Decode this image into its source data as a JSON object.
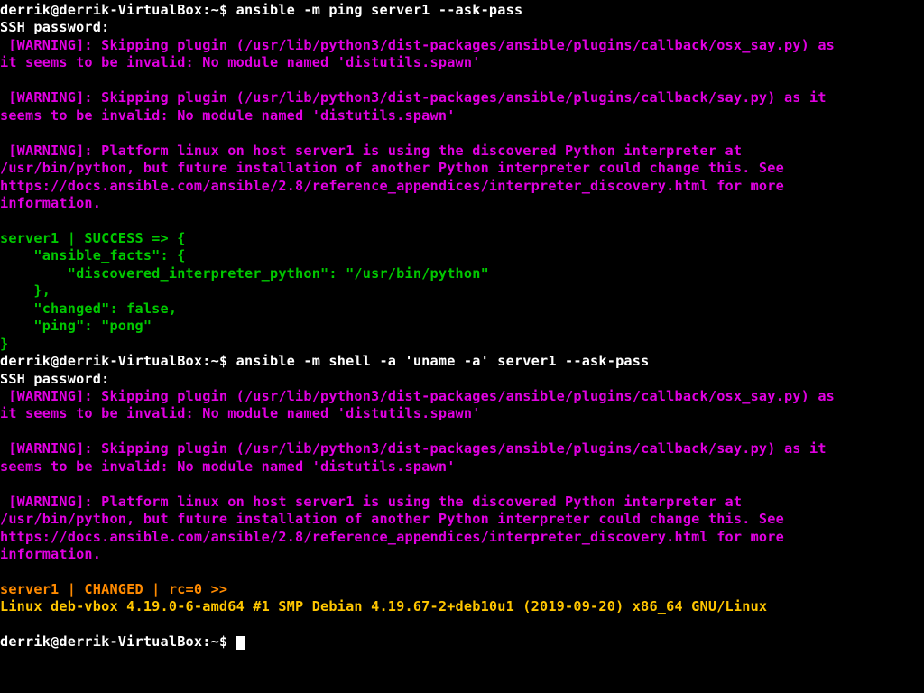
{
  "prompt1": {
    "userhost": "derrik@derrik-VirtualBox",
    "sep": ":",
    "path": "~",
    "dollar": "$ ",
    "command": "ansible -m ping server1 --ask-pass"
  },
  "ssh_password_label_1": "SSH password: ",
  "warn_osx_say": " [WARNING]: Skipping plugin (/usr/lib/python3/dist-packages/ansible/plugins/callback/osx_say.py) as\nit seems to be invalid: No module named 'distutils.spawn'",
  "warn_say": " [WARNING]: Skipping plugin (/usr/lib/python3/dist-packages/ansible/plugins/callback/say.py) as it\nseems to be invalid: No module named 'distutils.spawn'",
  "warn_interpreter": " [WARNING]: Platform linux on host server1 is using the discovered Python interpreter at\n/usr/bin/python, but future installation of another Python interpreter could change this. See\nhttps://docs.ansible.com/ansible/2.8/reference_appendices/interpreter_discovery.html for more\ninformation.",
  "success_block": "server1 | SUCCESS => {\n    \"ansible_facts\": {\n        \"discovered_interpreter_python\": \"/usr/bin/python\"\n    },\n    \"changed\": false,\n    \"ping\": \"pong\"\n}",
  "prompt2": {
    "userhost": "derrik@derrik-VirtualBox",
    "sep": ":",
    "path": "~",
    "dollar": "$ ",
    "command": "ansible -m shell -a 'uname -a' server1 --ask-pass"
  },
  "ssh_password_label_2": "SSH password: ",
  "changed_header": "server1 | CHANGED | rc=0 >>",
  "uname_output": "Linux deb-vbox 4.19.0-6-amd64 #1 SMP Debian 4.19.67-2+deb10u1 (2019-09-20) x86_64 GNU/Linux",
  "prompt3": {
    "userhost": "derrik@derrik-VirtualBox",
    "sep": ":",
    "path": "~",
    "dollar": "$ "
  }
}
